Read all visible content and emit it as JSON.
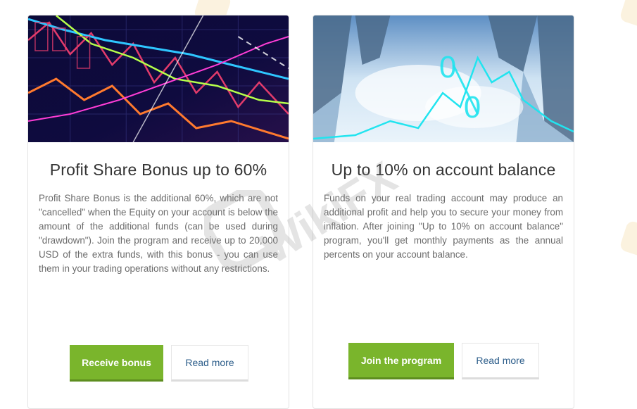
{
  "cards": [
    {
      "title": "Profit Share Bonus up to 60%",
      "body": "Profit Share Bonus is the additional 60%, which are not \"cancelled\" when the Equity on your account is below the amount of the additional funds (can be used during \"drawdown\"). Join the program and receive up to 20,000 USD of the extra funds, with this bonus - you can use them in your trading operations without any restrictions.",
      "primary_button": "Receive bonus",
      "secondary_button": "Read more"
    },
    {
      "title": "Up to 10% on account balance",
      "body": "Funds on your real trading account may produce an additional profit and help you to secure your money from inflation. After joining \"Up to 10% on account balance\" program, you'll get monthly payments as the annual percents on your account balance.",
      "primary_button": "Join the program",
      "secondary_button": "Read more"
    }
  ],
  "watermark": {
    "text": "WikiFX"
  },
  "colors": {
    "primary_button": "#7ab52c",
    "secondary_button_text": "#2c5d8a",
    "title_text": "#333333",
    "body_text": "#6b6b6b"
  }
}
